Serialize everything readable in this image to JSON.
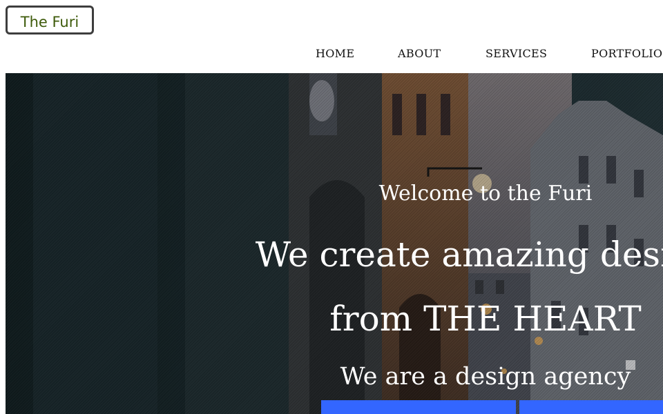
{
  "brand": {
    "logo_text": "The Furi",
    "logo_color": "#3d5a0a"
  },
  "nav": {
    "items": [
      {
        "label": "HOME"
      },
      {
        "label": "ABOUT"
      },
      {
        "label": "SERVICES"
      },
      {
        "label": "PORTFOLIO"
      }
    ]
  },
  "hero": {
    "welcome": "Welcome to the Furi",
    "headline_line1": "We create amazing design",
    "headline_line2": "from THE HEART",
    "tagline": "We are a design agency",
    "button_color": "#3366ff"
  }
}
